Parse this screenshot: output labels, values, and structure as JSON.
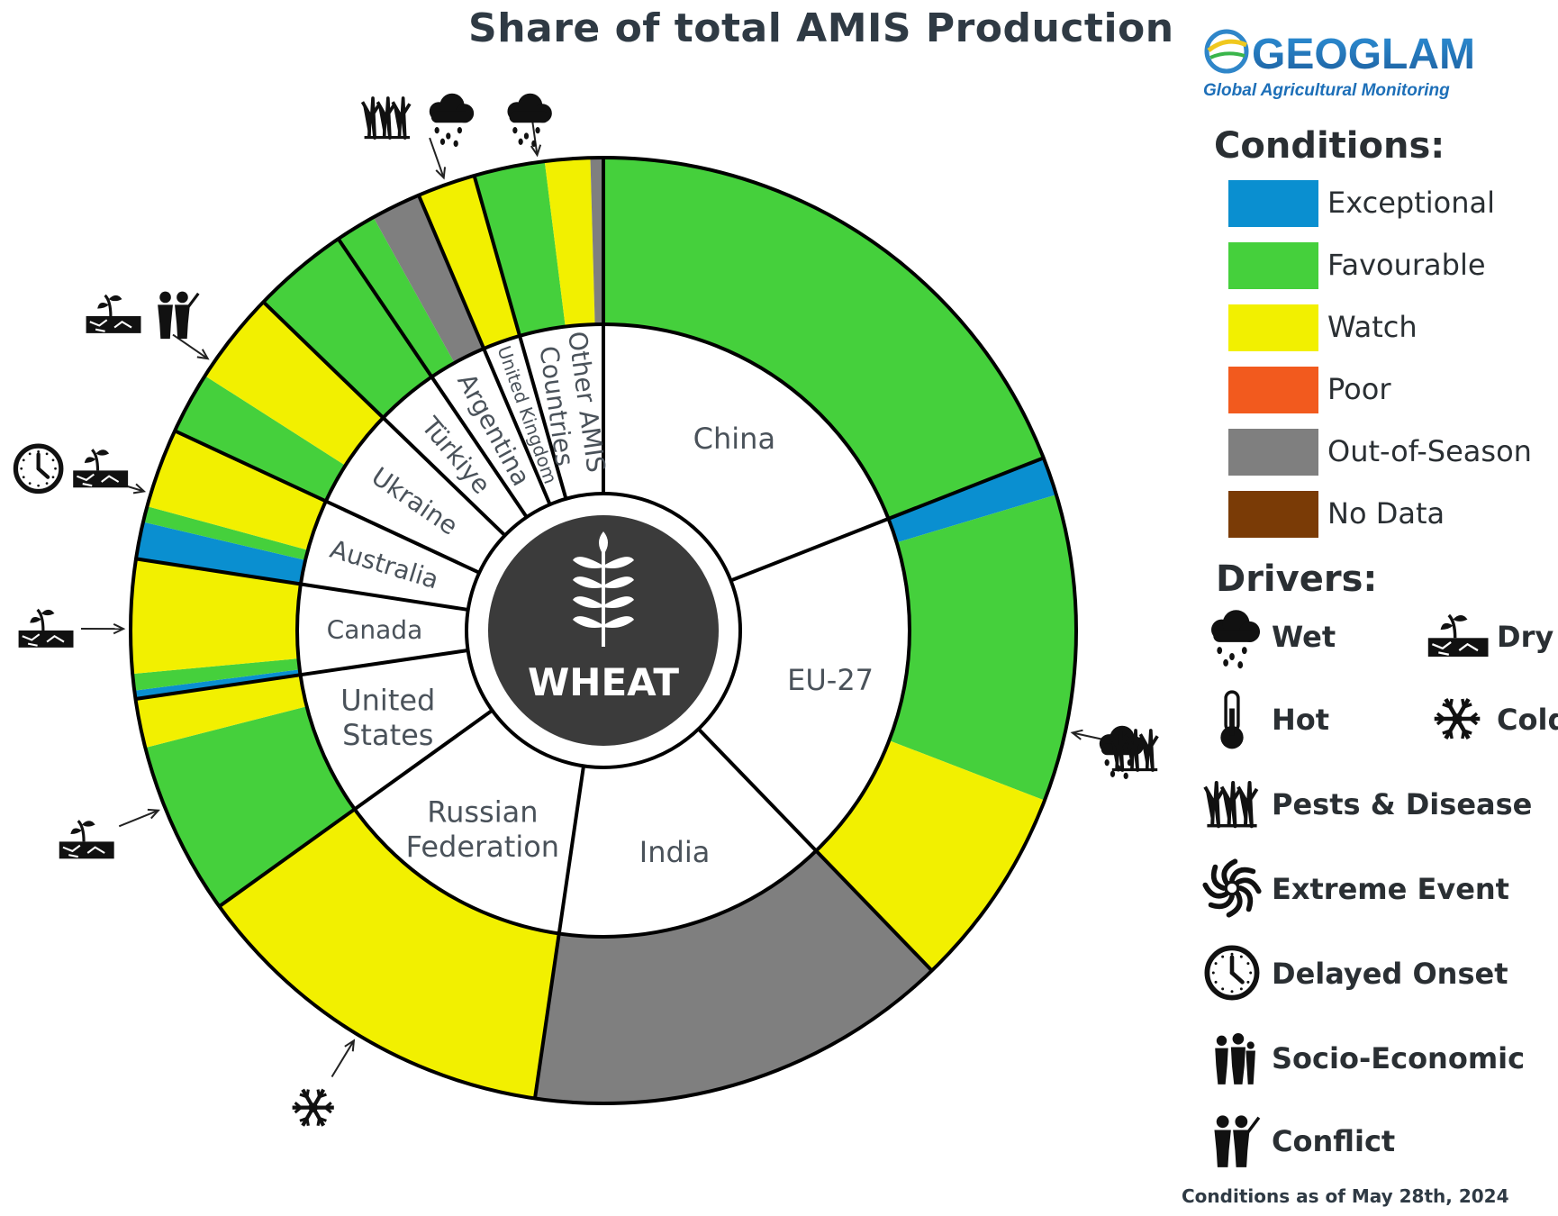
{
  "logo": {
    "name": "GEOGLAM",
    "tagline": "Global Agricultural Monitoring"
  },
  "legend": {
    "conditions_title": "Conditions:",
    "conditions": [
      {
        "label": "Exceptional",
        "color": "#0a8fd0"
      },
      {
        "label": "Favourable",
        "color": "#45d03c"
      },
      {
        "label": "Watch",
        "color": "#f2f000"
      },
      {
        "label": "Poor",
        "color": "#f25a1e"
      },
      {
        "label": "Out-of-Season",
        "color": "#7f7f7f"
      },
      {
        "label": "No Data",
        "color": "#7a3b06"
      }
    ],
    "drivers_title": "Drivers:",
    "drivers": [
      {
        "label": "Wet",
        "icon": "rain-cloud-icon"
      },
      {
        "label": "Dry",
        "icon": "dry-soil-icon"
      },
      {
        "label": "Hot",
        "icon": "thermometer-icon"
      },
      {
        "label": "Cold",
        "icon": "snowflake-icon"
      },
      {
        "label": "Pests & Disease",
        "icon": "pests-trees-icon"
      },
      {
        "label": "Extreme Event",
        "icon": "cyclone-icon"
      },
      {
        "label": "Delayed Onset",
        "icon": "clock-icon"
      },
      {
        "label": "Socio-Economic",
        "icon": "people-icon"
      },
      {
        "label": "Conflict",
        "icon": "conflict-icon"
      }
    ]
  },
  "footer": {
    "as_of": "Conditions as of May 28th, 2024"
  },
  "chart_data": {
    "type": "donut",
    "title": "Share of total AMIS Production",
    "center_label": "WHEAT",
    "center_icon": "wheat-icon",
    "start_angle_deg": 0,
    "direction": "clockwise",
    "countries": [
      {
        "name": "China",
        "label_lines": [
          "China"
        ],
        "share": 17.3,
        "conditions": [
          {
            "condition": "Favourable",
            "fraction": 1.0
          }
        ],
        "drivers": []
      },
      {
        "name": "EU-27",
        "label_lines": [
          "EU-27"
        ],
        "share": 17.0,
        "conditions": [
          {
            "condition": "Exceptional",
            "fraction": 0.07
          },
          {
            "condition": "Favourable",
            "fraction": 0.56
          },
          {
            "condition": "Watch",
            "fraction": 0.37
          }
        ],
        "drivers": [
          "rain-cloud-icon",
          "pests-trees-icon"
        ]
      },
      {
        "name": "India",
        "label_lines": [
          "India"
        ],
        "share": 13.2,
        "conditions": [
          {
            "condition": "Out-of-Season",
            "fraction": 1.0
          }
        ],
        "drivers": []
      },
      {
        "name": "Russian Federation",
        "label_lines": [
          "Russian",
          "Federation"
        ],
        "share": 11.6,
        "conditions": [
          {
            "condition": "Watch",
            "fraction": 1.0
          }
        ],
        "drivers": [
          "snowflake-icon"
        ]
      },
      {
        "name": "United States",
        "label_lines": [
          "United",
          "States"
        ],
        "share": 6.9,
        "conditions": [
          {
            "condition": "Favourable",
            "fraction": 0.78
          },
          {
            "condition": "Watch",
            "fraction": 0.22
          }
        ],
        "drivers": [
          "dry-soil-icon"
        ]
      },
      {
        "name": "Canada",
        "label_lines": [
          "Canada"
        ],
        "share": 4.3,
        "conditions": [
          {
            "condition": "Exceptional",
            "fraction": 0.06
          },
          {
            "condition": "Favourable",
            "fraction": 0.12
          },
          {
            "condition": "Watch",
            "fraction": 0.82
          }
        ],
        "drivers": [
          "dry-soil-icon"
        ]
      },
      {
        "name": "Australia",
        "label_lines": [
          "Australia"
        ],
        "share": 4.1,
        "conditions": [
          {
            "condition": "Exceptional",
            "fraction": 0.28
          },
          {
            "condition": "Favourable",
            "fraction": 0.12
          },
          {
            "condition": "Watch",
            "fraction": 0.6
          }
        ],
        "drivers": [
          "clock-icon",
          "dry-soil-icon"
        ]
      },
      {
        "name": "Ukraine",
        "label_lines": [
          "Ukraine"
        ],
        "share": 4.8,
        "conditions": [
          {
            "condition": "Favourable",
            "fraction": 0.4
          },
          {
            "condition": "Watch",
            "fraction": 0.6
          }
        ],
        "drivers": [
          "dry-soil-icon",
          "conflict-icon"
        ]
      },
      {
        "name": "Türkiye",
        "label_lines": [
          "Türkiye"
        ],
        "share": 3.0,
        "conditions": [
          {
            "condition": "Favourable",
            "fraction": 1.0
          }
        ],
        "drivers": []
      },
      {
        "name": "Argentina",
        "label_lines": [
          "Argentina"
        ],
        "share": 2.8,
        "conditions": [
          {
            "condition": "Favourable",
            "fraction": 0.45
          },
          {
            "condition": "Out-of-Season",
            "fraction": 0.55
          }
        ],
        "drivers": []
      },
      {
        "name": "United Kingdom",
        "label_lines": [
          "United Kingdom"
        ],
        "share": 1.8,
        "conditions": [
          {
            "condition": "Watch",
            "fraction": 1.0
          }
        ],
        "drivers": [
          "pests-trees-icon",
          "rain-cloud-icon"
        ]
      },
      {
        "name": "Other AMIS Countries",
        "label_lines": [
          "Other AMIS",
          "Countries"
        ],
        "share": 4.0,
        "conditions": [
          {
            "condition": "Favourable",
            "fraction": 0.55
          },
          {
            "condition": "Watch",
            "fraction": 0.35
          },
          {
            "condition": "Out-of-Season",
            "fraction": 0.1
          }
        ],
        "drivers": [
          "rain-cloud-icon"
        ]
      }
    ]
  }
}
